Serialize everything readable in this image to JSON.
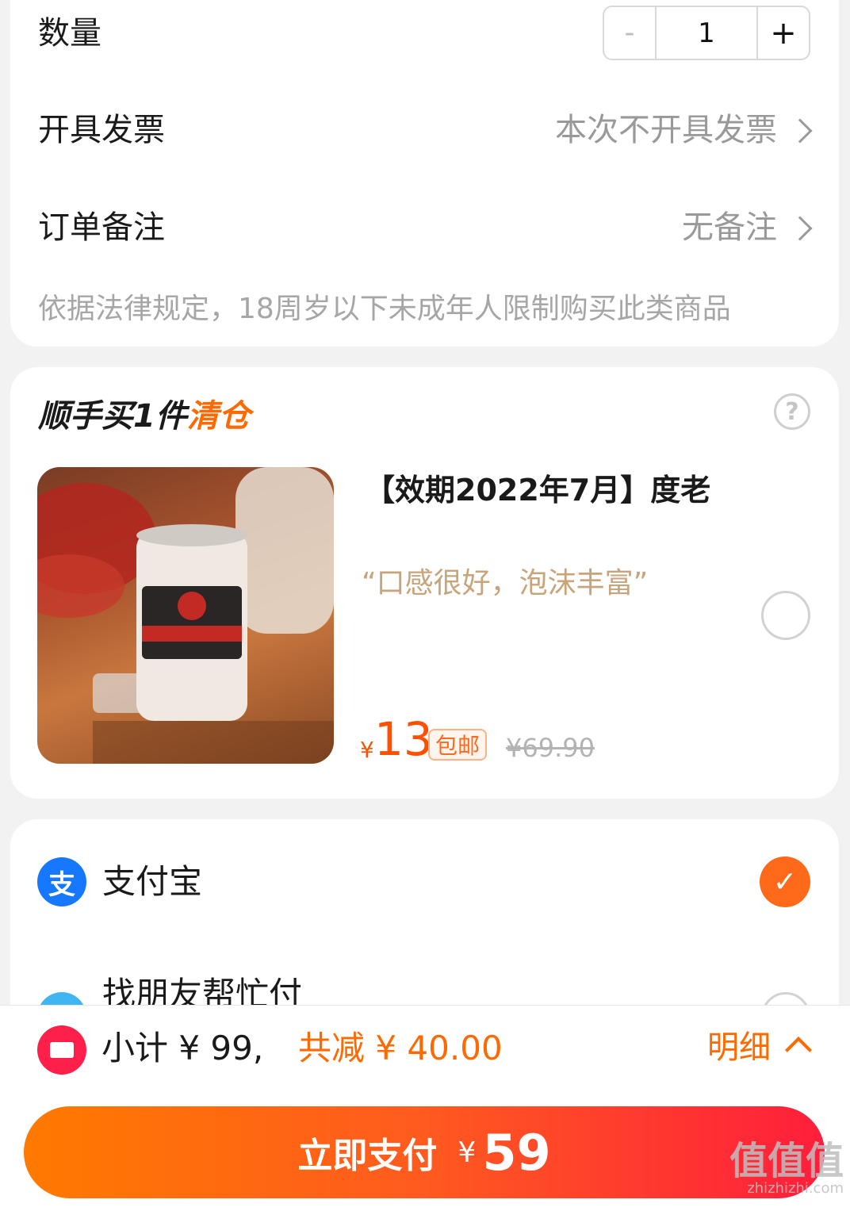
{
  "order": {
    "quantity_label": "数量",
    "quantity_minus": "-",
    "quantity_value": "1",
    "quantity_plus": "+",
    "invoice_label": "开具发票",
    "invoice_value": "本次不开具发票",
    "note_label": "订单备注",
    "note_value": "无备注",
    "legal_notice": "依据法律规定，18周岁以下未成年人限制购买此类商品"
  },
  "addon": {
    "title_prefix": "顺手买1件",
    "title_accent": "清仓",
    "help_symbol": "?",
    "product_name": "【效期2022年7月】度老",
    "product_quote": "“口感很好，泡沫丰富”",
    "price_yen": "¥",
    "price": "13",
    "shipping_tag": "包邮",
    "original_price": "¥69.90",
    "selected": false
  },
  "payment": {
    "methods": [
      {
        "label": "支付宝",
        "icon": "alipay-icon",
        "icon_glyph": "支",
        "selected": true
      },
      {
        "label": "找朋友帮忙付",
        "icon": "friend-pay-icon",
        "selected": false
      }
    ]
  },
  "footer": {
    "subtotal": "小计 ¥ 99,",
    "discount": "共减 ¥ 40.00",
    "detail": "明细",
    "pay_label": "立即支付",
    "pay_yen": "¥",
    "pay_amount": "59"
  },
  "watermark": {
    "main": "值值值",
    "sub": "zhizhizhi.com"
  },
  "colors": {
    "accent": "#ff6a00",
    "price": "#ff5000",
    "alipay_blue": "#1677ff",
    "coupon_red": "#ff1f4b"
  }
}
